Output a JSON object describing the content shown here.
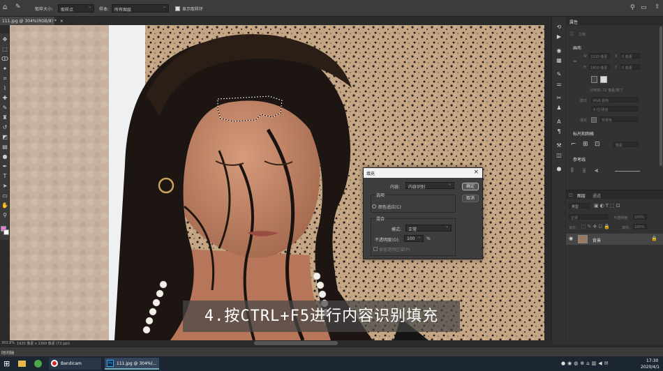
{
  "optbar": {
    "brush_size_label": "取样大小:",
    "brush_size_value": "取样点",
    "sample_label": "样本:",
    "sample_value": "所有图层",
    "show_ring_label": "显示取样环"
  },
  "document": {
    "tab_title": "111.jpg @ 304%(RGB/8) *"
  },
  "properties": {
    "tab": "属性",
    "doc_label": "文档",
    "canvas_title": "画布",
    "w_label": "W",
    "h_label": "H",
    "x_label": "X",
    "y_label": "Y",
    "w_value": "3320 像素",
    "h_value": "1800 像素",
    "x_value": "0 像素",
    "y_value": "0 像素",
    "resolution": "分辨率: 72 像素/英寸",
    "mode_label": "模式",
    "mode_value": "RGB 颜色",
    "depth_value": "8 位/通道",
    "fill_label": "填充",
    "fill_value": "背景色",
    "ruler_title": "标尺和网格",
    "ruler_unit": "像素",
    "guides_title": "参考线"
  },
  "layers": {
    "tab_layers": "图层",
    "tab_channels": "通道",
    "kind": "类型",
    "blend": "正常",
    "opacity_label": "不透明度:",
    "opacity_value": "100%",
    "lock_label": "锁定:",
    "fill_label": "填充:",
    "fill_value": "100%",
    "layer_name": "背景"
  },
  "dialog": {
    "title": "填充",
    "content_label": "内容:",
    "content_value": "内容识别",
    "ok": "确定",
    "cancel": "取消",
    "options_title": "选项",
    "color_adapt": "颜色适应(C)",
    "blend_title": "混合",
    "mode_label": "模式:",
    "mode_value": "正常",
    "opacity_label": "不透明度(O):",
    "opacity_value": "100",
    "percent": "%",
    "preserve": "保留透明区域(P)"
  },
  "status": {
    "zoom": "303.8%",
    "size": "1920 像素 x 1369 像素 (72 ppi)"
  },
  "timeline": {
    "label": "时间轴"
  },
  "taskbar": {
    "app1": "Bandicam",
    "app2": "111.jpg @ 304%(...",
    "time": "17:30",
    "date": "2020/4/1"
  },
  "caption": "4.按CTRL+F5进行内容识别填充"
}
